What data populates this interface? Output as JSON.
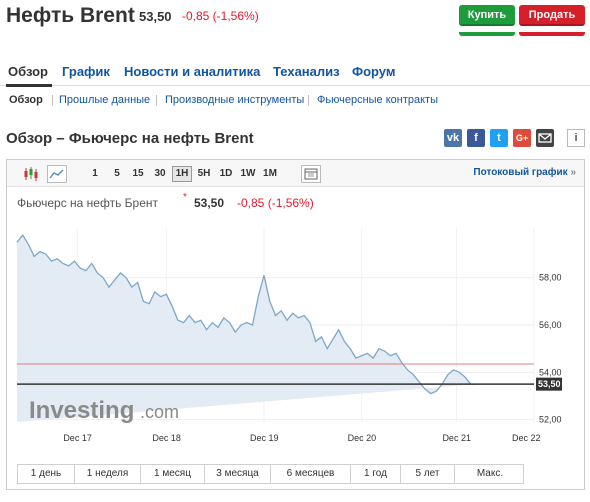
{
  "header": {
    "title": "Нефть Brent",
    "price": "53,50",
    "change": "-0,85 (-1,56%)",
    "buy_label": "Купить",
    "sell_label": "Продать"
  },
  "nav": {
    "tabs": [
      "Обзор",
      "График",
      "Новости и аналитика",
      "Теханализ",
      "Форум"
    ],
    "active": 0
  },
  "subnav": {
    "tabs": [
      "Обзор",
      "Прошлые данные",
      "Производные инструменты",
      "Фьючерсные контракты"
    ],
    "active": 0
  },
  "section": {
    "title": "Обзор – Фьючерс на нефть Brent",
    "share_icons": [
      "vk-icon",
      "facebook-icon",
      "twitter-icon",
      "google-plus-icon",
      "mail-icon"
    ],
    "info": "i"
  },
  "toolbar": {
    "intervals": [
      "1",
      "5",
      "15",
      "30",
      "1H",
      "5H",
      "1D",
      "1W",
      "1M"
    ],
    "active_interval": "1H",
    "stream_label": "Потоковый график",
    "stream_arrow": "»"
  },
  "chart": {
    "title": "Фьючерс на нефть Брент",
    "star": "*",
    "price": "53,50",
    "change": "-0,85",
    "change_pct": "(-1,56%)",
    "watermark_bold": "Investing",
    "watermark_light": ".com",
    "colors": {
      "line": "#7fa6c9",
      "fill": "#e3ecf4",
      "ref": "#e07d7d",
      "accent_red": "#e3182d",
      "link": "#1256a0"
    }
  },
  "chart_data": {
    "type": "area",
    "x_ticks": [
      "Dec 17",
      "Dec 18",
      "Dec 19",
      "Dec 20",
      "Dec 21",
      "Dec 22"
    ],
    "y_ticks": [
      "52,00",
      "54,00",
      "56,00",
      "58,00"
    ],
    "ylim": [
      51.9,
      60.1
    ],
    "current_value": 53.5,
    "current_label": "53,50",
    "reference_value": 54.35,
    "x": [
      0.0,
      0.2,
      0.4,
      0.6,
      0.8,
      1.0,
      1.2,
      1.4,
      1.6,
      1.8,
      2.0,
      2.2,
      2.4,
      2.6,
      2.8,
      3.0,
      3.2,
      3.4,
      3.6,
      3.8,
      4.0,
      4.2,
      4.4,
      4.6,
      4.8,
      5.0,
      5.2,
      5.4,
      5.6,
      5.8,
      6.0,
      6.2,
      6.4,
      6.6,
      6.8,
      7.0,
      7.2,
      7.4,
      7.6,
      7.8,
      8.0,
      8.2,
      8.4,
      8.6,
      8.8,
      9.0,
      9.2,
      9.4,
      9.6,
      9.8,
      10.0,
      10.2,
      10.4,
      10.6,
      10.8,
      11.0,
      11.2,
      11.4,
      11.6,
      11.8,
      12.0,
      12.2,
      12.4,
      12.6,
      12.8,
      13.0,
      13.2,
      13.4,
      13.6,
      13.8,
      14.0,
      14.2,
      14.4,
      14.6,
      14.8,
      15.0,
      15.2,
      15.4,
      15.6,
      15.8,
      16.0,
      16.2,
      16.4,
      16.6,
      16.8,
      17.0,
      17.2,
      17.4,
      17.6,
      17.8,
      18.0
    ],
    "y": [
      59.5,
      59.8,
      59.4,
      58.9,
      59.1,
      59.0,
      58.7,
      58.8,
      58.6,
      58.5,
      58.7,
      58.4,
      58.3,
      58.6,
      58.2,
      58.0,
      57.6,
      57.9,
      58.2,
      58.0,
      57.6,
      57.8,
      57.0,
      56.9,
      57.4,
      57.2,
      57.3,
      56.8,
      56.2,
      56.1,
      56.4,
      56.1,
      56.2,
      55.8,
      56.1,
      55.9,
      56.3,
      56.1,
      55.7,
      56.0,
      56.1,
      56.0,
      57.2,
      58.1,
      57.0,
      56.4,
      56.6,
      56.2,
      56.5,
      56.3,
      56.4,
      56.1,
      55.3,
      55.5,
      55.0,
      55.4,
      55.8,
      55.3,
      55.0,
      54.6,
      54.7,
      54.8,
      54.6,
      55.0,
      54.9,
      54.7,
      54.8,
      54.4,
      54.1,
      53.9,
      53.6,
      53.3,
      53.1,
      53.2,
      53.5,
      53.9,
      54.1,
      54.0,
      53.8,
      53.5,
      53.5
    ],
    "xlabel": "",
    "ylabel": "",
    "grid": true,
    "legend": "none"
  },
  "ranges": [
    "1 день",
    "1 неделя",
    "1 месяц",
    "3 месяца",
    "6 месяцев",
    "1 год",
    "5 лет",
    "Макс."
  ]
}
